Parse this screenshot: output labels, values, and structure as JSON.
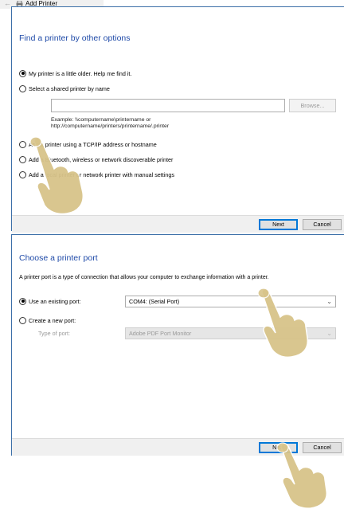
{
  "window": {
    "title": "Add Printer",
    "back_icon": "back-arrow-icon",
    "app_icon": "printer-icon"
  },
  "step1": {
    "heading": "Find a printer by other options",
    "options": [
      {
        "label": "My printer is a little older. Help me find it.",
        "checked": true
      },
      {
        "label": "Select a shared printer by name",
        "checked": false
      },
      {
        "label": "Add a printer using a TCP/IP address or hostname",
        "checked": false
      },
      {
        "label": "Add a Bluetooth, wireless or network discoverable printer",
        "checked": false
      },
      {
        "label": "Add a local printer or network printer with manual settings",
        "checked": false
      }
    ],
    "shared_printer_input": {
      "value": "",
      "placeholder": ""
    },
    "browse_label": "Browse...",
    "example_line1": "Example: \\\\computername\\printername or",
    "example_line2": "http://computername/printers/printername/.printer",
    "next_label": "Next",
    "cancel_label": "Cancel"
  },
  "step2": {
    "heading": "Choose a printer port",
    "description": "A printer port is a type of connection that allows your computer to exchange information with a printer.",
    "use_existing_label": "Use an existing port:",
    "use_existing_checked": true,
    "existing_port_value": "COM4: (Serial Port)",
    "create_new_label": "Create a new port:",
    "create_new_checked": false,
    "type_of_port_label": "Type of port:",
    "type_of_port_value": "Adobe PDF Port Monitor",
    "next_label": "Next",
    "cancel_label": "Cancel"
  },
  "colors": {
    "heading": "#1f4aa8",
    "frame": "#3c6fa8",
    "hand": "#d8c48a"
  }
}
